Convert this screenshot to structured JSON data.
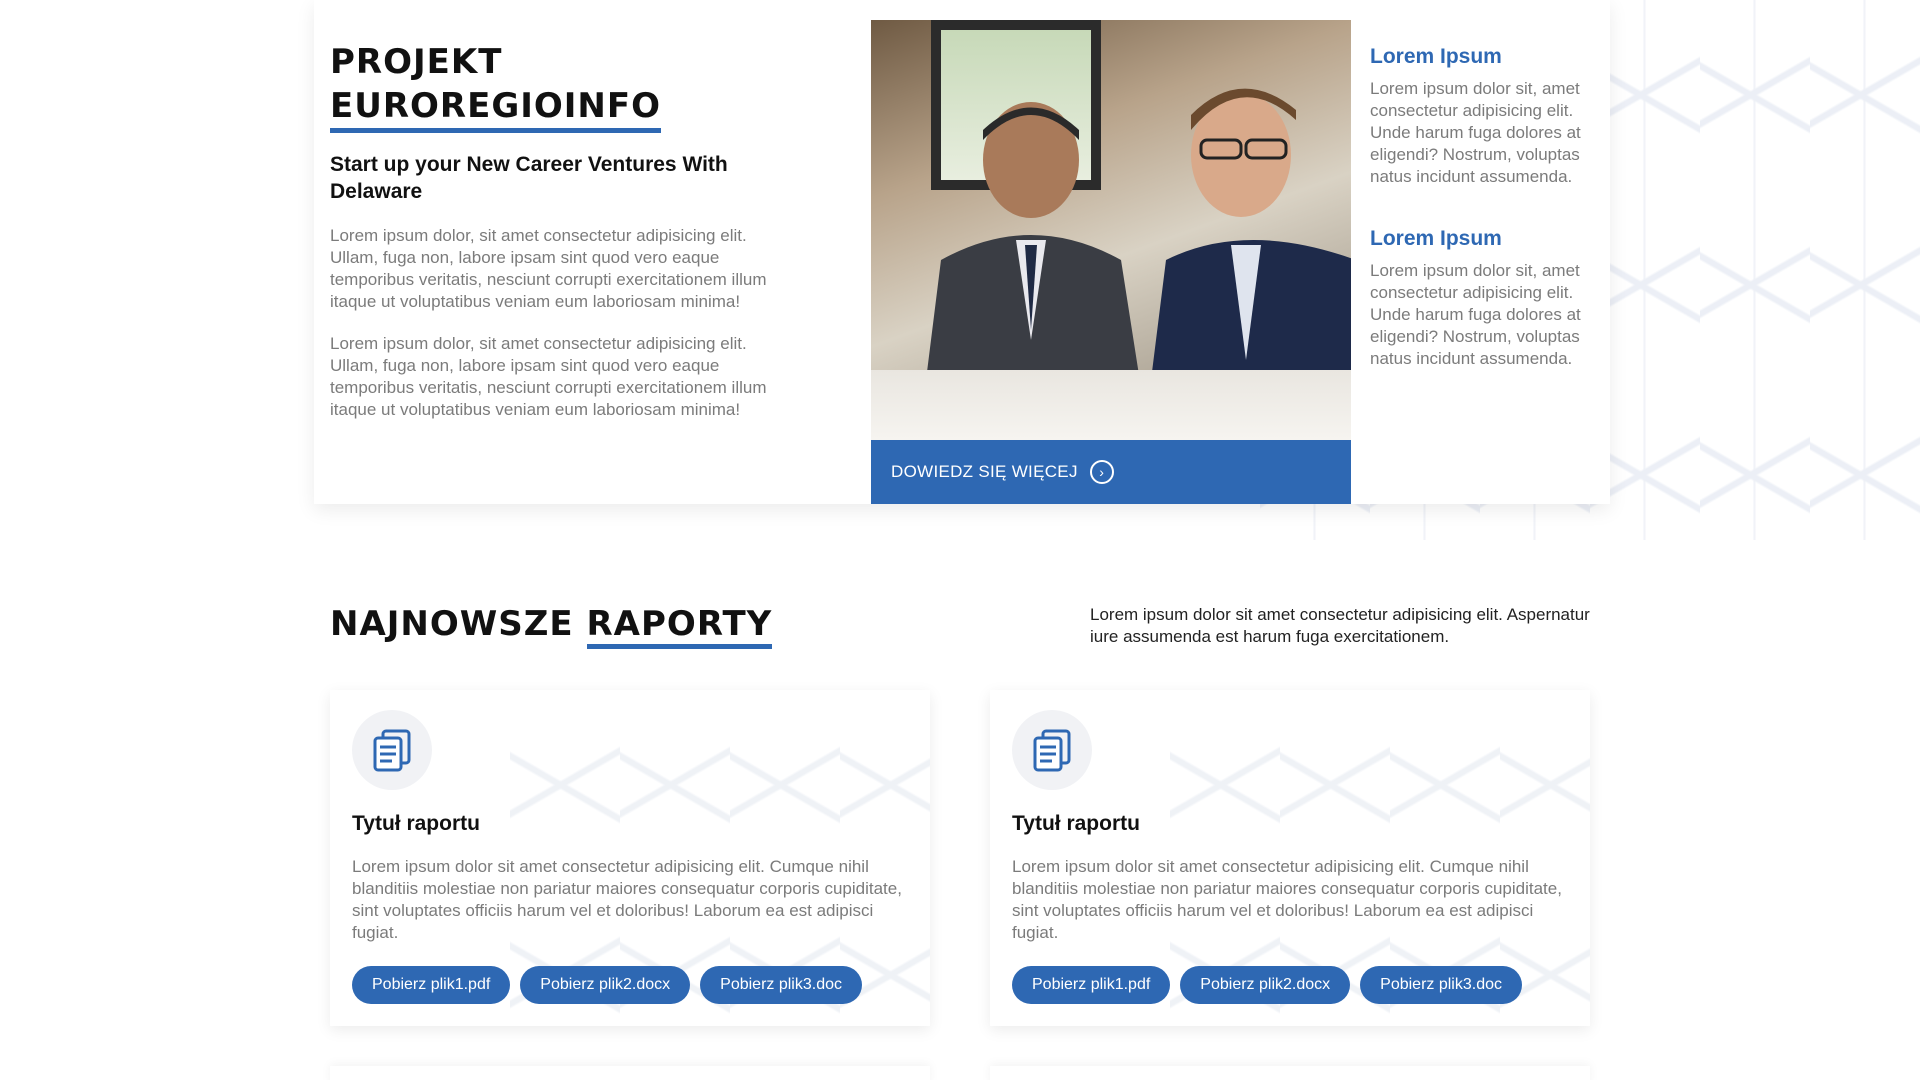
{
  "intro": {
    "title_line1": "PROJEKT",
    "title_line2": "EUROREGIOINFO",
    "subtitle": "Start up your New Career Ventures With Delaware",
    "paragraph1": "Lorem ipsum dolor, sit amet consectetur adipisicing elit. Ullam, fuga non, labore ipsam sint quod vero eaque temporibus veritatis, nesciunt corrupti exercitationem illum itaque ut voluptatibus veniam eum laboriosam minima!",
    "paragraph2": "Lorem ipsum dolor, sit amet consectetur adipisicing elit. Ullam, fuga non, labore ipsam sint quod vero eaque temporibus veritatis, nesciunt corrupti exercitationem illum itaque ut voluptatibus veniam eum laboriosam minima!"
  },
  "photo": {
    "cta_label": "DOWIEDZ SIĘ WIĘCEJ"
  },
  "features": [
    {
      "title": "Lorem Ipsum",
      "text": "Lorem ipsum dolor sit, amet consectetur adipisicing elit. Unde harum fuga dolores at eligendi? Nostrum, voluptas natus incidunt assumenda."
    },
    {
      "title": "Lorem Ipsum",
      "text": "Lorem ipsum dolor sit, amet consectetur adipisicing elit. Unde harum fuga dolores at eligendi? Nostrum, voluptas natus incidunt assumenda."
    }
  ],
  "reports": {
    "title_word1": "NAJNOWSZE",
    "title_word2": "RAPORTY",
    "description": "Lorem ipsum dolor sit amet consectetur adipisicing elit. Aspernatur iure assumenda est harum fuga exercitationem.",
    "cards": [
      {
        "icon": "document-icon",
        "title": "Tytuł raportu",
        "text": "Lorem ipsum dolor sit amet consectetur adipisicing elit. Cumque nihil blanditiis molestiae non pariatur maiores consequatur corporis cupiditate, sint voluptates officiis harum vel et doloribus! Laborum ea est adipisci fugiat.",
        "buttons": [
          "Pobierz plik1.pdf",
          "Pobierz plik2.docx",
          "Pobierz plik3.doc"
        ]
      },
      {
        "icon": "document-icon",
        "title": "Tytuł raportu",
        "text": "Lorem ipsum dolor sit amet consectetur adipisicing elit. Cumque nihil blanditiis molestiae non pariatur maiores consequatur corporis cupiditate, sint voluptates officiis harum vel et doloribus! Laborum ea est adipisci fugiat.",
        "buttons": [
          "Pobierz plik1.pdf",
          "Pobierz plik2.docx",
          "Pobierz plik3.doc"
        ]
      }
    ]
  },
  "colors": {
    "accent": "#2e68b3",
    "body_text": "#7b7b7b",
    "heading": "#111111"
  }
}
